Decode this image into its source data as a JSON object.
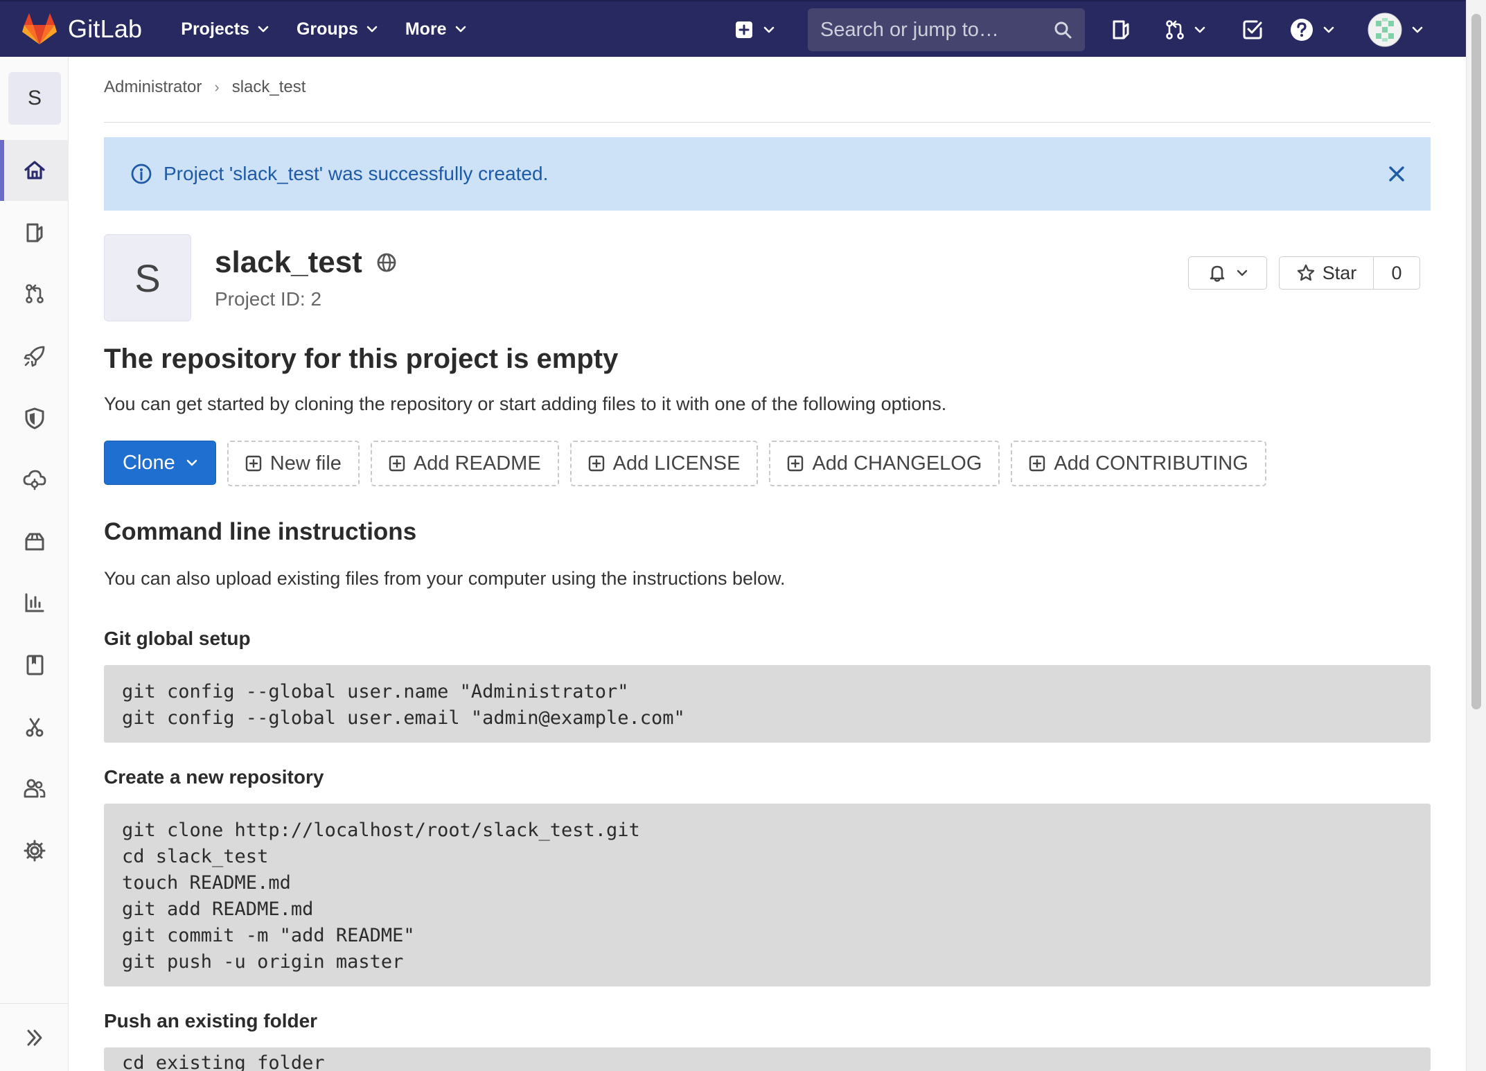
{
  "colors": {
    "navbar_bg": "#292961",
    "accent_blue": "#1f6fd0",
    "alert_bg": "#cde2f6",
    "alert_text": "#1e5aa5",
    "sidebar_active": "#6b6bc7"
  },
  "navbar": {
    "brand": "GitLab",
    "menu": [
      {
        "label": "Projects",
        "icon": "chevron-down-icon"
      },
      {
        "label": "Groups",
        "icon": "chevron-down-icon"
      },
      {
        "label": "More",
        "icon": "chevron-down-icon"
      }
    ],
    "search_placeholder": "Search or jump to…"
  },
  "sidebar": {
    "project_letter": "S",
    "items": [
      {
        "name": "project-overview",
        "icon": "home-icon",
        "active": true
      },
      {
        "name": "issues",
        "icon": "issues-icon"
      },
      {
        "name": "merge-requests",
        "icon": "merge-request-icon"
      },
      {
        "name": "ci-cd",
        "icon": "rocket-icon"
      },
      {
        "name": "security",
        "icon": "shield-icon"
      },
      {
        "name": "operations",
        "icon": "cloud-gear-icon"
      },
      {
        "name": "packages",
        "icon": "package-icon"
      },
      {
        "name": "analytics",
        "icon": "chart-icon"
      },
      {
        "name": "wiki",
        "icon": "book-icon"
      },
      {
        "name": "snippets",
        "icon": "scissors-icon"
      },
      {
        "name": "members",
        "icon": "users-icon"
      },
      {
        "name": "settings",
        "icon": "gear-icon"
      }
    ],
    "collapse_icon": "double-chevron-right-icon"
  },
  "breadcrumb": {
    "items": [
      "Administrator",
      "slack_test"
    ]
  },
  "alert": {
    "message": "Project 'slack_test' was successfully created."
  },
  "project": {
    "avatar_letter": "S",
    "name": "slack_test",
    "id_text": "Project ID: 2",
    "star_label": "Star",
    "star_count": "0"
  },
  "empty_repo": {
    "title": "The repository for this project is empty",
    "description": "You can get started by cloning the repository or start adding files to it with one of the following options.",
    "clone_label": "Clone",
    "actions": [
      "New file",
      "Add README",
      "Add LICENSE",
      "Add CHANGELOG",
      "Add CONTRIBUTING"
    ]
  },
  "cli": {
    "title": "Command line instructions",
    "description": "You can also upload existing files from your computer using the instructions below.",
    "sections": [
      {
        "title": "Git global setup",
        "lines": [
          "git config --global user.name \"Administrator\"",
          "git config --global user.email \"admin@example.com\""
        ]
      },
      {
        "title": "Create a new repository",
        "lines": [
          "git clone http://localhost/root/slack_test.git",
          "cd slack_test",
          "touch README.md",
          "git add README.md",
          "git commit -m \"add README\"",
          "git push -u origin master"
        ]
      },
      {
        "title": "Push an existing folder",
        "lines": [
          "cd existing_folder"
        ]
      }
    ]
  }
}
